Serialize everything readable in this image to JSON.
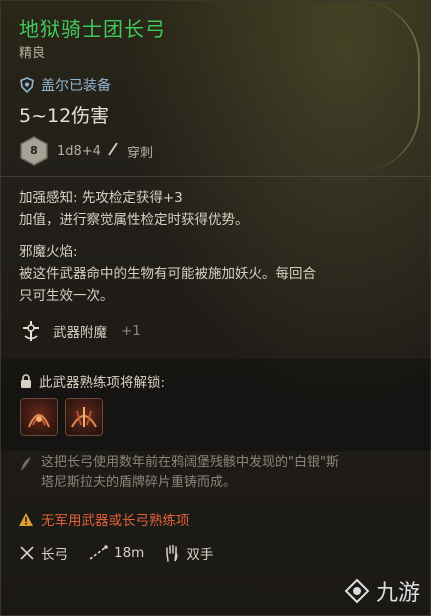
{
  "item": {
    "name": "地狱骑士团长弓",
    "rarity": "精良",
    "equipped_by": "盖尔已装备",
    "damage": "5~12伤害",
    "dice": {
      "face": "8",
      "formula": "1d8+4",
      "type": "穿刺"
    }
  },
  "traits": [
    {
      "line1": "加强感知: 先攻检定获得+3",
      "line2": "加值，进行察觉属性检定时获得优势。"
    },
    {
      "line1": "邪魔火焰:",
      "line2": "被这件武器命中的生物有可能被施加妖火。每回合",
      "line3": "只可生效一次。"
    }
  ],
  "passive": {
    "label": "武器附魔",
    "value": "+1"
  },
  "unlock": {
    "title": "此武器熟练项将解锁:"
  },
  "lore": {
    "line1": "这把长弓使用数年前在鸦阔堡残骸中发现的\"白银\"斯",
    "line2": "塔尼斯拉夫的盾牌碎片重铸而成。"
  },
  "warning": "无军用武器或长弓熟练项",
  "properties": {
    "weapon_type": "长弓",
    "range": "18m",
    "handedness": "双手"
  },
  "watermark": "九游",
  "colors": {
    "title": "#3ec95a",
    "warning": "#e0623a",
    "equipped": "#8fb6d0"
  }
}
